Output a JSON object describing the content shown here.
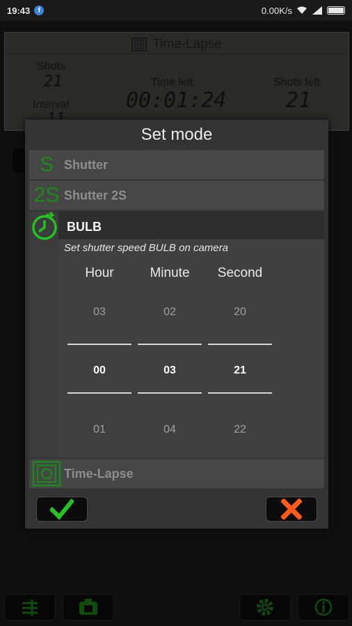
{
  "status": {
    "time": "19:43",
    "fb": "f",
    "speed": "0.00K/s"
  },
  "lcd": {
    "title": "Time-Lapse",
    "shots_label": "Shots",
    "shots_value": "21",
    "interval_label": "Interval",
    "interval_value": "11",
    "time_left_label": "Time left",
    "time_left_value": "00:01:24",
    "shots_left_label": "Shots left",
    "shots_left_value": "21"
  },
  "dialog": {
    "title": "Set mode",
    "modes": [
      {
        "icon_text": "S",
        "label": "Shutter"
      },
      {
        "icon_text": "2S",
        "label": "Shutter 2S"
      },
      {
        "icon_text": "",
        "label": "BULB"
      },
      {
        "icon_text": "",
        "label": "Time-Lapse"
      }
    ],
    "bulb_description": "Set shutter speed BULB on camera",
    "picker": {
      "columns": [
        "Hour",
        "Minute",
        "Second"
      ],
      "above": [
        "03",
        "02",
        "20"
      ],
      "selected": [
        "00",
        "03",
        "21"
      ],
      "below": [
        "01",
        "04",
        "22"
      ]
    },
    "ok_icon": "check-icon",
    "cancel_icon": "x-icon"
  },
  "colors": {
    "accent_green": "#22c422",
    "dark_green": "#1a8a1a",
    "cancel_red": "#ff5a1a"
  },
  "toolbar_icons": [
    "sliders-icon",
    "camera-mode-icon",
    "gear-icon",
    "info-icon"
  ]
}
